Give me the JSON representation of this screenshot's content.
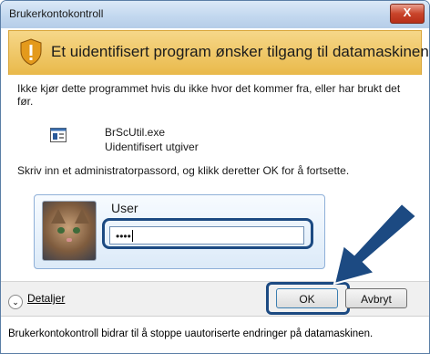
{
  "window": {
    "title": "Brukerkontokontroll",
    "close_label": "X"
  },
  "banner": {
    "text": "Et uidentifisert program ønsker tilgang til datamaskinen"
  },
  "content": {
    "warning": "Ikke kjør dette programmet hvis du ikke hvor det kommer fra, eller har brukt det før.",
    "program_name": "BrScUtil.exe",
    "publisher": "Uidentifisert utgiver",
    "instruction": "Skriv inn et administratorpassord, og klikk deretter OK for å fortsette."
  },
  "credentials": {
    "user_label": "User",
    "password_mask": "••••"
  },
  "footer": {
    "details_label": "Detaljer",
    "ok_label": "OK",
    "cancel_label": "Avbryt"
  },
  "info": {
    "text": "Brukerkontokontroll bidrar til å stoppe uautoriserte endringer på datamaskinen."
  },
  "colors": {
    "accent": "#1c4a82",
    "banner": "#f0c966"
  }
}
